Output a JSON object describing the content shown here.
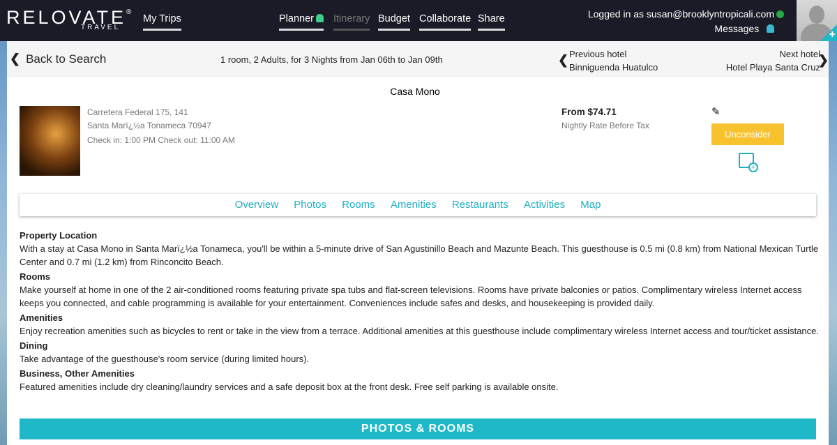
{
  "header": {
    "logo": "RELOVATE",
    "logo_sub": "TRAVEL",
    "nav": [
      {
        "label": "My Trips"
      },
      {
        "label": "Planner"
      },
      {
        "label": "Itinerary"
      },
      {
        "label": "Budget"
      },
      {
        "label": "Collaborate"
      },
      {
        "label": "Share"
      }
    ],
    "logged_in": "Logged in as susan@brooklyntropicali.com",
    "messages": "Messages"
  },
  "subheader": {
    "back": "Back to Search",
    "summary": "1 room, 2 Adults, for 3 Nights from Jan 06th to Jan 09th",
    "prev_label": "Previous hotel",
    "prev_name": "Binniguenda Huatulco",
    "next_label": "Next hotel",
    "next_name": "Hotel Playa Santa Cruz"
  },
  "hotel": {
    "name": "Casa Mono",
    "address1": "Carretera Federal 175, 141",
    "address2": "Santa Marï¿½a Tonameca 70947",
    "checkin": "Check in: 1:00 PM Check out: 11:00 AM",
    "price": "From $74.71",
    "price_note": "Nightly Rate Before Tax",
    "unconsider": "Unconsider"
  },
  "tabs": [
    "Overview",
    "Photos",
    "Rooms",
    "Amenities",
    "Restaurants",
    "Activities",
    "Map"
  ],
  "sections": [
    {
      "title": "Property Location",
      "text": "With a stay at Casa Mono in Santa Marï¿½a Tonameca, you'll be within a 5-minute drive of San Agustinillo Beach and Mazunte Beach. This guesthouse is 0.5 mi (0.8 km) from National Mexican Turtle Center and 0.7 mi (1.2 km) from Rinconcito Beach."
    },
    {
      "title": "Rooms",
      "text": "Make yourself at home in one of the 2 air-conditioned rooms featuring private spa tubs and flat-screen televisions. Rooms have private balconies or patios. Complimentary wireless Internet access keeps you connected, and cable programming is available for your entertainment. Conveniences include safes and desks, and housekeeping is provided daily."
    },
    {
      "title": "Amenities",
      "text": "Enjoy recreation amenities such as bicycles to rent or take in the view from a terrace. Additional amenities at this guesthouse include complimentary wireless Internet access and tour/ticket assistance."
    },
    {
      "title": "Dining",
      "text": "Take advantage of the guesthouse's room service (during limited hours)."
    },
    {
      "title": "Business, Other Amenities",
      "text": "Featured amenities include dry cleaning/laundry services and a safe deposit box at the front desk. Free self parking is available onsite."
    }
  ],
  "photos_rooms": "PHOTOS & ROOMS",
  "colors": {
    "accent": "#1fb8c8",
    "header": "#1a1b26",
    "button": "#f8c22e"
  }
}
